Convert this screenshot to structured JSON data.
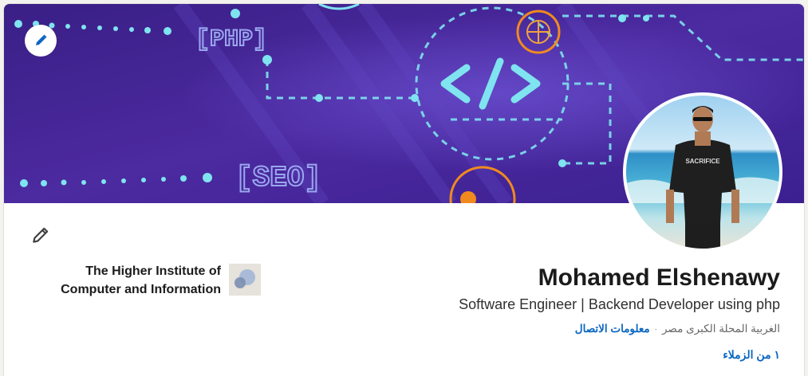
{
  "banner": {
    "image_name": "code-tech-background",
    "labels": {
      "php": "[PHP]",
      "seo": "[SEO]",
      "code": "</>"
    },
    "colors": {
      "bg": "#4a2b9a",
      "accent": "#7fe3f0",
      "orange": "#f08a1f"
    }
  },
  "edit_cover": {
    "icon": "pencil-icon",
    "color": "#0a66c2"
  },
  "profile": {
    "name": "Mohamed Elshenawy",
    "headline": "Software Engineer | Backend Developer using php",
    "location": "الغربية المحلة الكبرى مصر",
    "separator": "·",
    "contact_label": "معلومات الاتصال",
    "connections": "١ من الزملاء",
    "photo_badge_text": "SACRIFICE"
  },
  "education": {
    "name": "The Higher Institute of Computer and Information",
    "logo_icon": "school-logo"
  },
  "colors": {
    "link": "#0a66c2",
    "text": "#1b1b1b",
    "muted": "#666666"
  }
}
